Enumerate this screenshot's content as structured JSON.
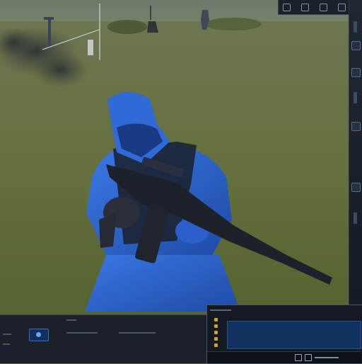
{
  "scene": {
    "character": "soldier-in-blue-uniform-and-hood",
    "weapon": "assault-rifle-icon",
    "terrain": "grass-field",
    "effect": "smoke-cloud"
  },
  "colors": {
    "uniform_blue": "#2d62c9",
    "hud_dark": "#1b2029",
    "hud_accent": "#2f6fd0",
    "slot_amber": "#d0a52c",
    "inventory_blue": "#12335f"
  },
  "top_toolbar": {
    "icons": [
      "menu-icon",
      "settings-icon",
      "camera-icon",
      "close-icon"
    ]
  },
  "side_strip": {
    "buttons": [
      "tool-icon",
      "layer-icon",
      "camera-icon",
      "zoom-icon"
    ]
  },
  "hud_left": {
    "icon": "ammo-icon"
  },
  "hud_right": {
    "slot_icons": [
      "slot-icon",
      "slot-icon",
      "slot-icon",
      "slot-icon",
      "slot-icon"
    ],
    "bar_icons": [
      "inventory-icon",
      "equip-icon"
    ]
  }
}
